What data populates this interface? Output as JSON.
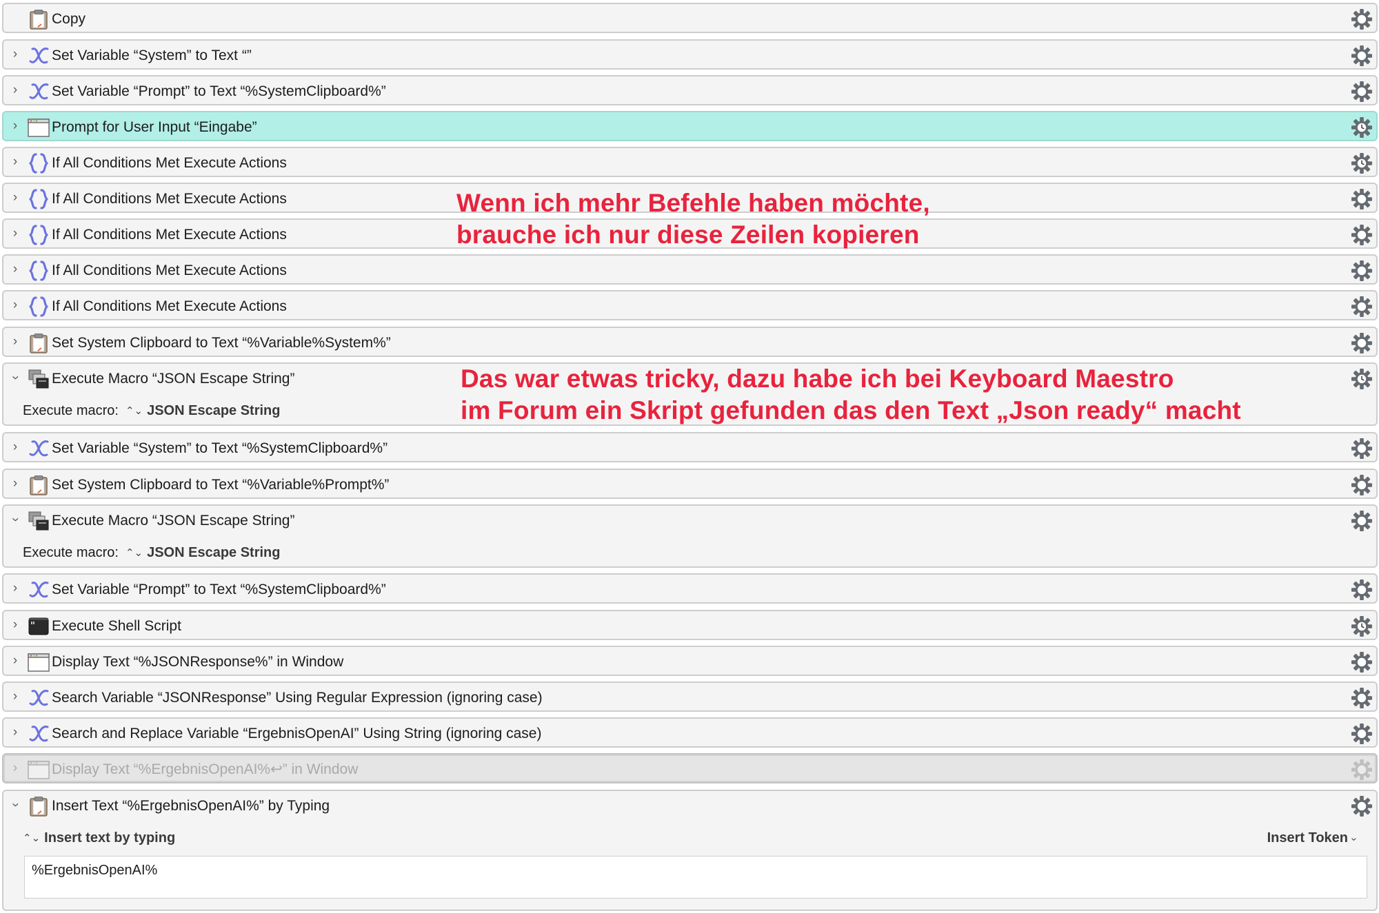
{
  "actions": [
    {
      "title": "Copy",
      "icon": "clipboard-icon",
      "chevron": "none"
    },
    {
      "title": "Set Variable “System” to Text “”",
      "icon": "variable-icon",
      "chevron": "collapsed"
    },
    {
      "title": "Set Variable “Prompt” to Text “%SystemClipboard%”",
      "icon": "variable-icon",
      "chevron": "collapsed"
    },
    {
      "title": "Prompt for User Input “Eingabe”",
      "icon": "window-icon",
      "chevron": "collapsed",
      "state": "selected"
    },
    {
      "title": "If All Conditions Met Execute Actions",
      "icon": "braces-icon",
      "chevron": "collapsed"
    },
    {
      "title": "If All Conditions Met Execute Actions",
      "icon": "braces-icon",
      "chevron": "collapsed"
    },
    {
      "title": "If All Conditions Met Execute Actions",
      "icon": "braces-icon",
      "chevron": "collapsed"
    },
    {
      "title": "If All Conditions Met Execute Actions",
      "icon": "braces-icon",
      "chevron": "collapsed"
    },
    {
      "title": "If All Conditions Met Execute Actions",
      "icon": "braces-icon",
      "chevron": "collapsed"
    },
    {
      "title": "Set System Clipboard to Text “%Variable%System%”",
      "icon": "clipboard-icon",
      "chevron": "collapsed"
    },
    {
      "title": "Execute Macro “JSON Escape String”",
      "icon": "execute-macro-icon",
      "chevron": "expanded",
      "detail": {
        "label": "Execute macro:",
        "stepper": "⌃⌄",
        "value": "JSON Escape String"
      }
    },
    {
      "title": "Set Variable “System” to Text “%SystemClipboard%”",
      "icon": "variable-icon",
      "chevron": "collapsed"
    },
    {
      "title": "Set System Clipboard to Text “%Variable%Prompt%”",
      "icon": "clipboard-icon",
      "chevron": "collapsed"
    },
    {
      "title": "Execute Macro “JSON Escape String”",
      "icon": "execute-macro-icon",
      "chevron": "expanded",
      "detail": {
        "label": "Execute macro:",
        "stepper": "⌃⌄",
        "value": "JSON Escape String"
      }
    },
    {
      "title": "Set Variable “Prompt” to Text “%SystemClipboard%”",
      "icon": "variable-icon",
      "chevron": "collapsed"
    },
    {
      "title": "Execute Shell Script",
      "icon": "terminal-icon",
      "chevron": "collapsed"
    },
    {
      "title": "Display Text “%JSONResponse%” in Window",
      "icon": "window-icon",
      "chevron": "collapsed"
    },
    {
      "title": "Search Variable “JSONResponse” Using Regular Expression (ignoring case)",
      "icon": "variable-icon",
      "chevron": "collapsed"
    },
    {
      "title": "Search and Replace Variable “ErgebnisOpenAI” Using String (ignoring case)",
      "icon": "variable-icon",
      "chevron": "collapsed"
    },
    {
      "title": "Display Text “%ErgebnisOpenAI%↩” in Window",
      "icon": "window-icon",
      "chevron": "collapsed",
      "state": "disabled"
    },
    {
      "title": "Insert Text “%ErgebnisOpenAI%” by Typing",
      "icon": "clipboard-icon",
      "chevron": "expanded",
      "insert": {
        "mode": "Insert text by typing",
        "token_menu": "Insert Token",
        "text": "%ErgebnisOpenAI%"
      }
    }
  ],
  "annotations": [
    {
      "lines": [
        "Wenn ich mehr Befehle haben möchte,",
        "brauche ich nur diese Zeilen kopieren"
      ]
    },
    {
      "lines": [
        "Das war etwas tricky, dazu habe ich bei Keyboard Maestro",
        "im Forum ein Skript gefunden das den Text „Json ready“ macht"
      ]
    }
  ],
  "colors": {
    "annotation": "#e8233d",
    "selected_row": "#b2efe7",
    "row_background": "#f4f4f4",
    "variable_icon": "#6b73e0"
  }
}
